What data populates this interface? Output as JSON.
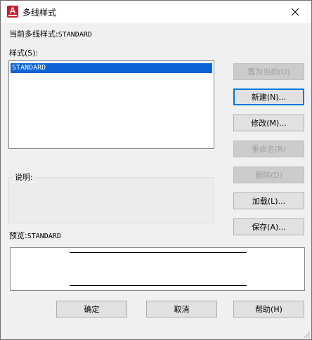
{
  "window": {
    "title": "多线样式",
    "app_icon_letter": "A",
    "close_glyph": "✕"
  },
  "current_style": {
    "label": "当前多线样式:",
    "value": "STANDARD"
  },
  "styles_list": {
    "label": "样式(S):",
    "items": [
      "STANDARD"
    ],
    "selected": "STANDARD"
  },
  "description": {
    "label": "说明:",
    "value": ""
  },
  "preview": {
    "label": "预览:",
    "value": "STANDARD"
  },
  "side_buttons": {
    "set_current": "置为当前(U)",
    "new": "新建(N)...",
    "modify": "修改(M)...",
    "rename": "重命名(R)",
    "delete": "删除(D)",
    "load": "加载(L)...",
    "save": "保存(A)..."
  },
  "bottom_buttons": {
    "ok": "确定",
    "cancel": "取消",
    "help": "帮助(H)"
  },
  "colors": {
    "selection": "#0a64d6",
    "dialog_bg": "#f0f0f0",
    "focus_border": "#0078d7",
    "app_icon": "#c4202e"
  }
}
